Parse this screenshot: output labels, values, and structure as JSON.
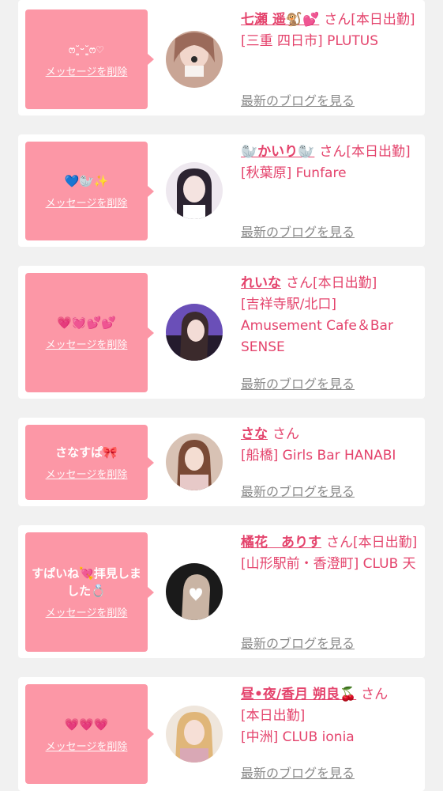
{
  "cards": [
    {
      "message": "ෆ˘͈ᵕ˘͈ෆ♡",
      "delete_label": "メッセージを削除",
      "name": "七瀬 遥🐒💕",
      "san": "さん",
      "detail_1": "[本日出勤]",
      "detail_2": "[三重 四日市] PLUTUS",
      "blog_label": "最新のブログを見る"
    },
    {
      "message": "💙🦭✨",
      "delete_label": "メッセージを削除",
      "name": "🦭かいり🦭",
      "san": "さん",
      "detail_1": "[本日出勤]",
      "detail_2": "[秋葉原] Funfare",
      "blog_label": "最新のブログを見る"
    },
    {
      "message": "💗💓💕💕",
      "delete_label": "メッセージを削除",
      "name": "れいな",
      "san": "さん",
      "detail_1": "[本日出勤]",
      "detail_2": "[吉祥寺駅/北口] Amusement Cafe＆Bar SENSE",
      "blog_label": "最新のブログを見る"
    },
    {
      "message": "さなすぱ🎀",
      "delete_label": "メッセージを削除",
      "name": "さな",
      "san": "さん",
      "detail_1": "",
      "detail_2": "[船橋] Girls Bar HANABI",
      "blog_label": "最新のブログを見る"
    },
    {
      "message": "すぱいね💘拝見しました💍",
      "delete_label": "メッセージを削除",
      "name": "橘花　ありす",
      "san": "さん",
      "detail_1": "[本日出勤]",
      "detail_2": "[山形駅前・香澄町] CLUB 天",
      "blog_label": "最新のブログを見る"
    },
    {
      "message": "💗💗💗",
      "delete_label": "メッセージを削除",
      "name": "昼•夜/香月 朔良🍒",
      "san": "さん",
      "detail_1": "[本日出勤]",
      "detail_2": "[中洲] CLUB ionia",
      "blog_label": "最新のブログを見る"
    }
  ],
  "colors": {
    "bubble": "#fc97a6",
    "name": "#e4436c",
    "link_gray": "#8a8a8a",
    "background": "#f1f1f1"
  }
}
